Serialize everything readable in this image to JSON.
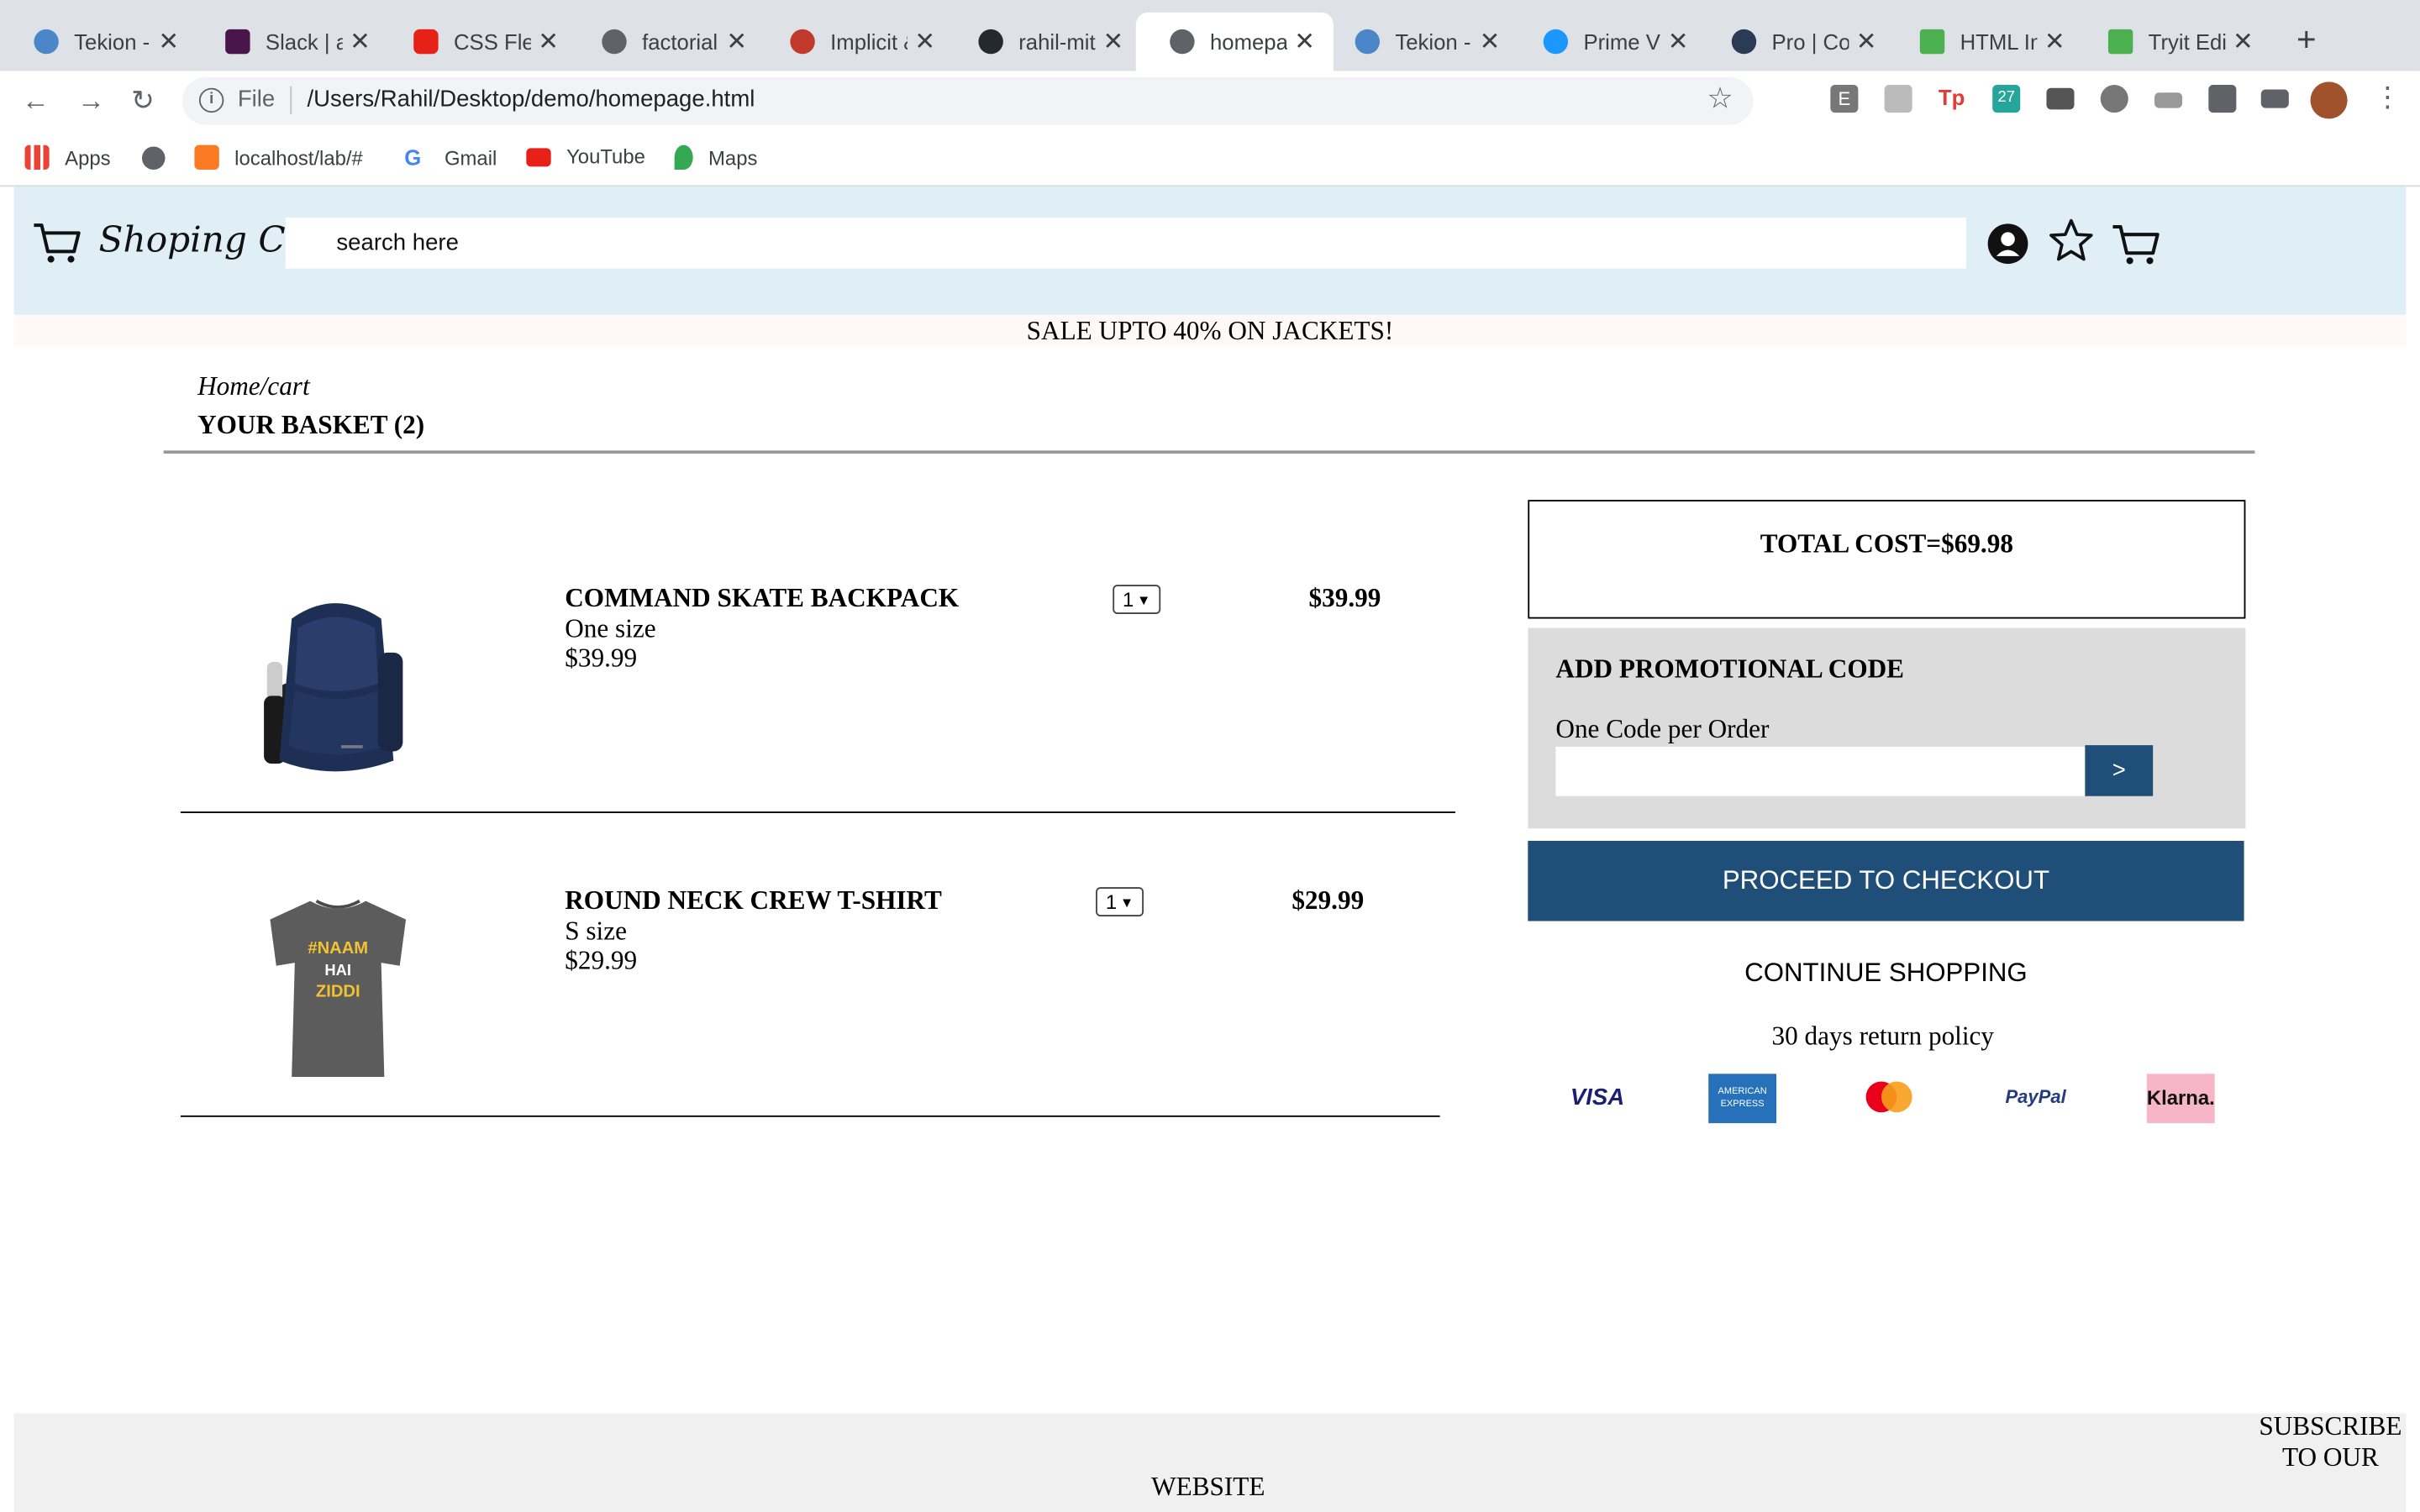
{
  "browser": {
    "tabs": [
      {
        "title": "Tekion -",
        "color": "#4a86c8"
      },
      {
        "title": "Slack | a",
        "color": "#4a154b"
      },
      {
        "title": "CSS Flex",
        "color": "#e62117"
      },
      {
        "title": "factorial",
        "color": "#5f6368"
      },
      {
        "title": "Implicit &",
        "color": "#c0392b"
      },
      {
        "title": "rahil-mit",
        "color": "#24292e"
      },
      {
        "title": "homepa",
        "color": "#5f6368"
      },
      {
        "title": "Tekion -",
        "color": "#4a86c8"
      },
      {
        "title": "Prime Vi",
        "color": "#1a98ff"
      },
      {
        "title": "Pro | Coc",
        "color": "#2b3a55"
      },
      {
        "title": "HTML Im",
        "color": "#4caf50"
      },
      {
        "title": "Tryit Edi",
        "color": "#4caf50"
      }
    ],
    "active_tab": 6,
    "url_scheme": "File",
    "url": "/Users/Rahil/Desktop/demo/homepage.html",
    "bookmarks": [
      "Apps",
      "localhost/lab/#",
      "Gmail",
      "YouTube",
      "Maps"
    ]
  },
  "header": {
    "brand": "Shoping Cart",
    "search_placeholder": "search here"
  },
  "promo_banner": "SALE UPTO 40% ON JACKETS!",
  "breadcrumb": "Home/cart",
  "basket_title": "YOUR BASKET (2)",
  "items": [
    {
      "name": "COMMAND SKATE BACKPACK",
      "variant": "One size",
      "unit_price": "$39.99",
      "qty": "1",
      "total": "$39.99"
    },
    {
      "name": "ROUND NECK CREW T-SHIRT",
      "variant": "S size",
      "unit_price": "$29.99",
      "qty": "1",
      "total": "$29.99",
      "print_lines": [
        "#NAAM",
        "HAI",
        "ZIDDI"
      ]
    }
  ],
  "summary": {
    "total": "TOTAL COST=$69.98",
    "promo_title": "ADD PROMOTIONAL CODE",
    "promo_note": "One Code per Order",
    "promo_submit": ">",
    "checkout": "PROCEED TO CHECKOUT",
    "continue": "CONTINUE SHOPPING",
    "policy": "30 days return policy",
    "payments": [
      {
        "label": "VISA"
      },
      {
        "label": "AMERICAN EXPRESS"
      },
      {
        "label": ""
      },
      {
        "label": "PayPal"
      },
      {
        "label": "Klarna."
      }
    ]
  },
  "footer": {
    "website": "WEBSITE",
    "subscribe": "SUBSCRIBE TO OUR"
  }
}
